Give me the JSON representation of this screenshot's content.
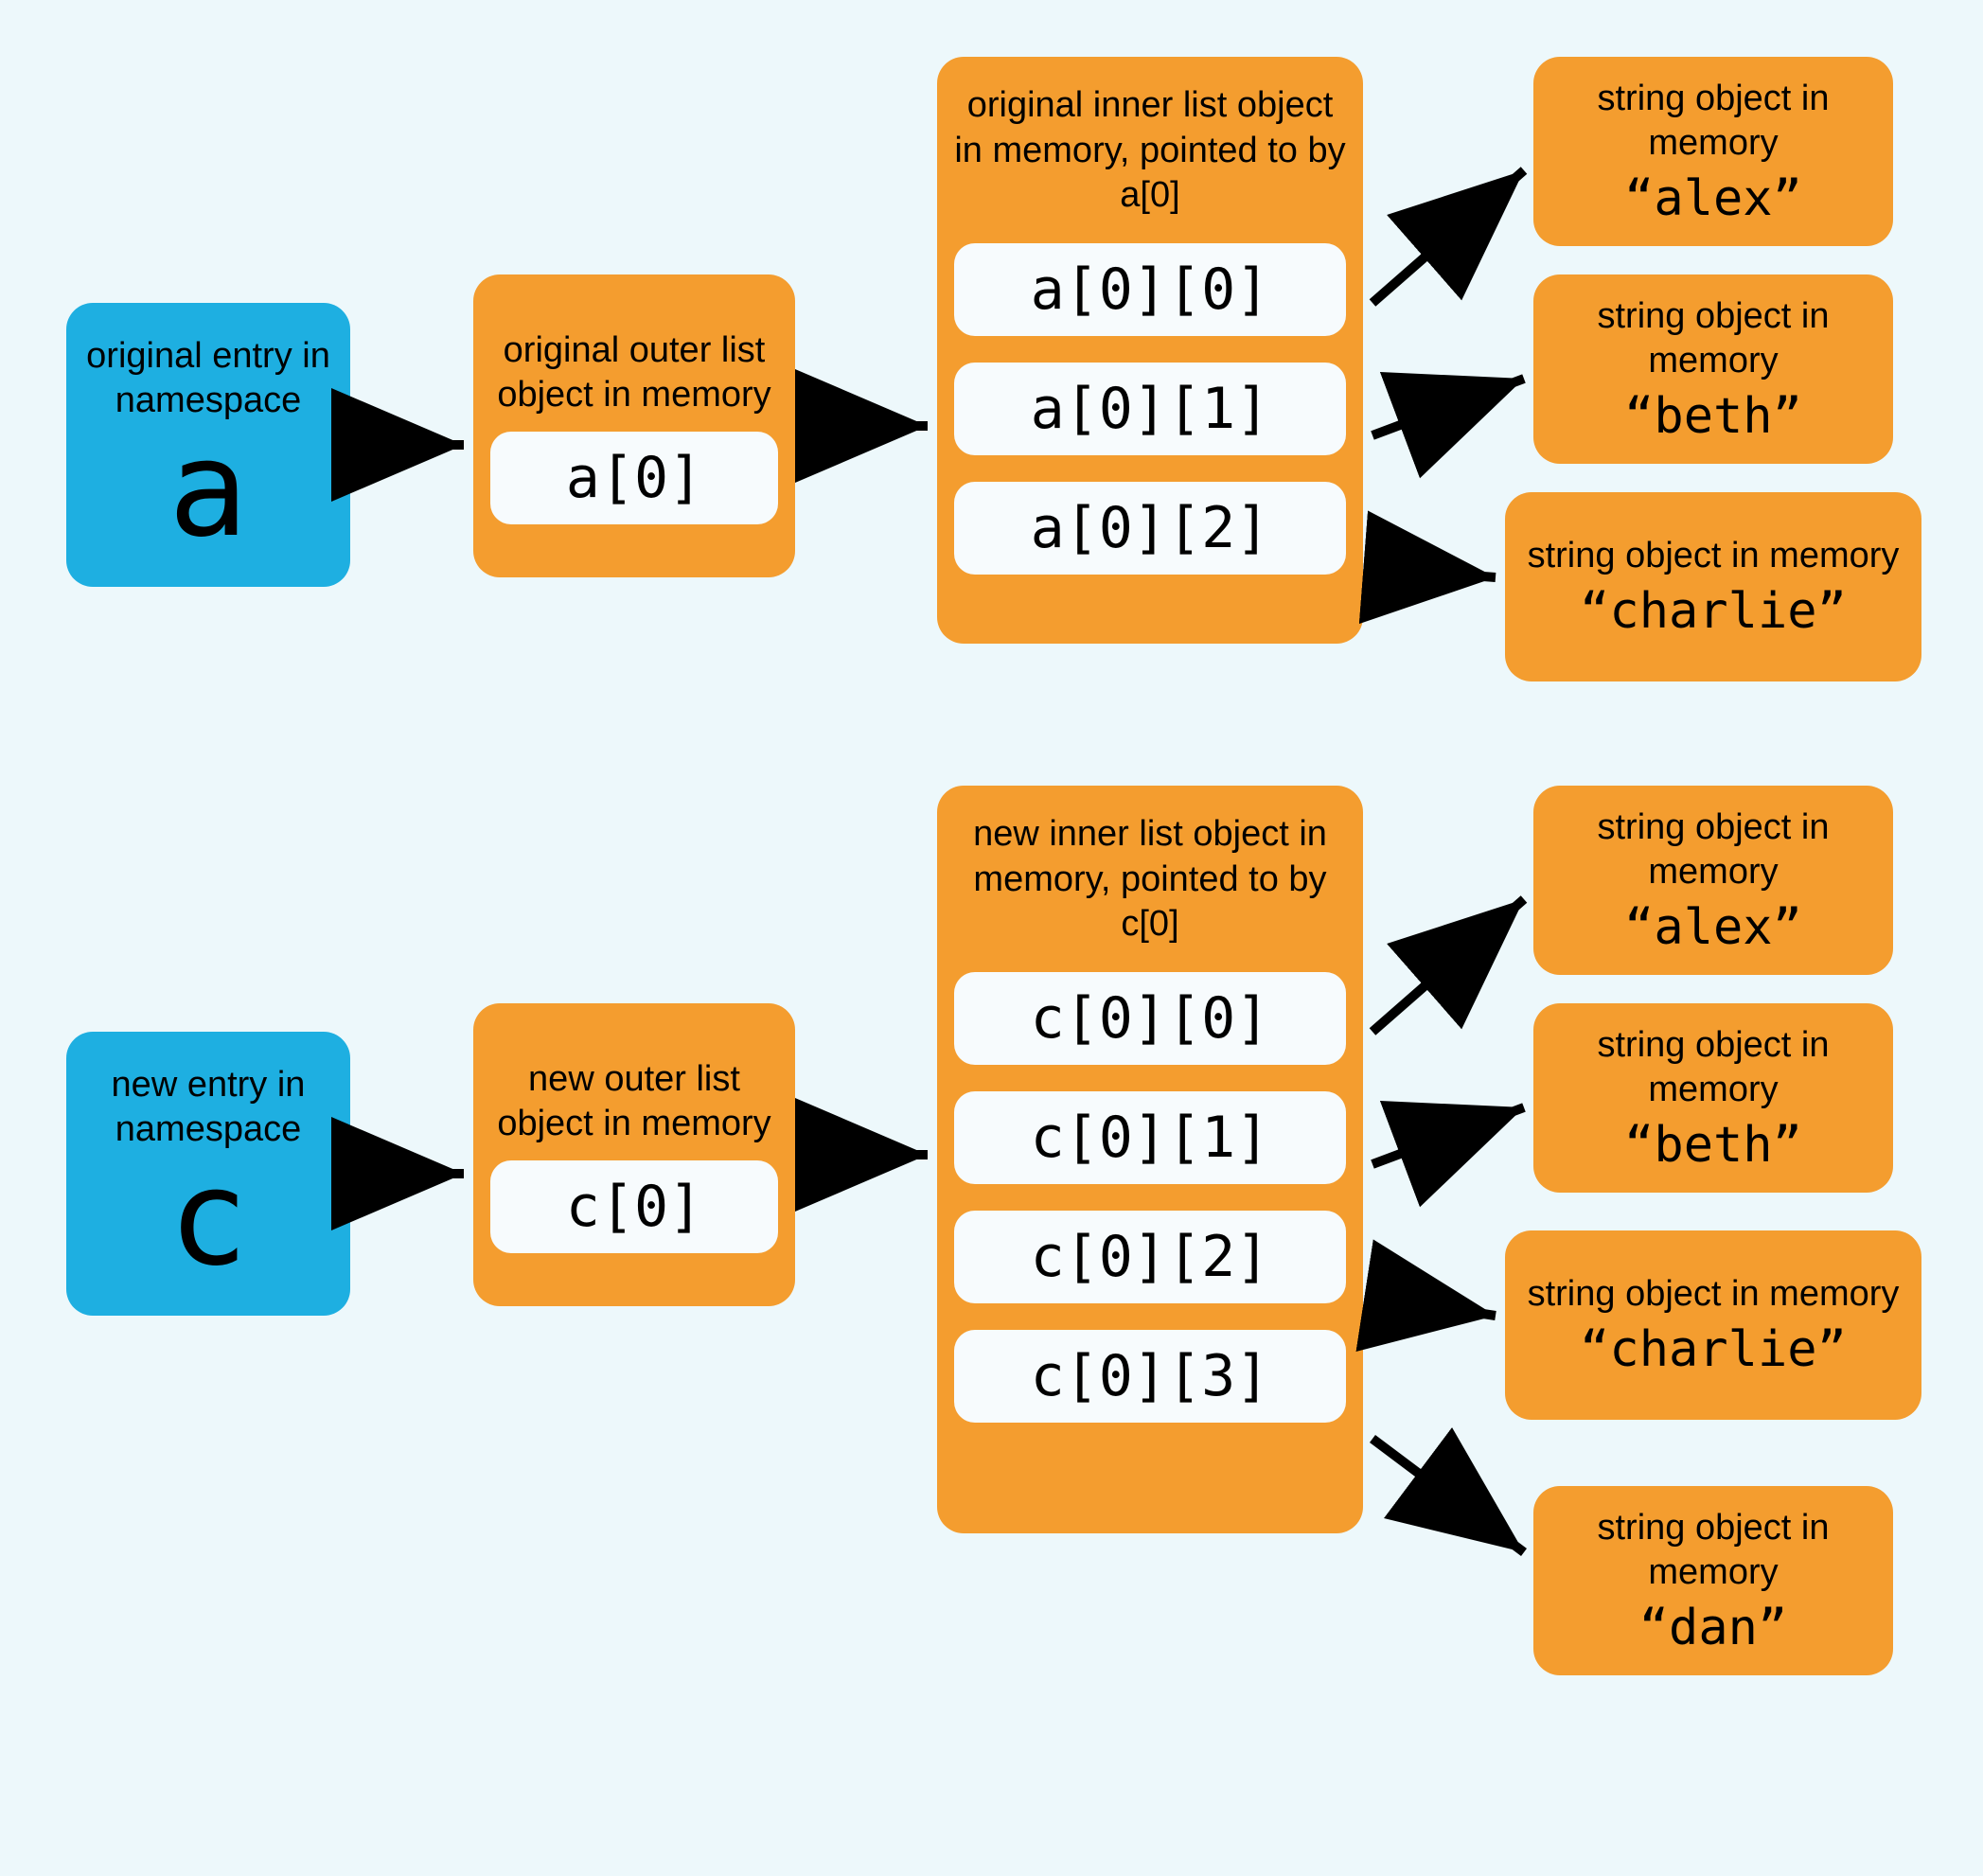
{
  "namespace_a": {
    "label": "original entry in namespace",
    "var": "a"
  },
  "namespace_c": {
    "label": "new entry in namespace",
    "var": "c"
  },
  "outer_a": {
    "label": "original outer list object in memory",
    "slot": "a[0]"
  },
  "outer_c": {
    "label": "new outer list object in memory",
    "slot": "c[0]"
  },
  "inner_a": {
    "label": "original inner list object in memory, pointed to by a[0]",
    "slots": [
      "a[0][0]",
      "a[0][1]",
      "a[0][2]"
    ]
  },
  "inner_c": {
    "label": "new inner list object in memory, pointed to by c[0]",
    "slots": [
      "c[0][0]",
      "c[0][1]",
      "c[0][2]",
      "c[0][3]"
    ]
  },
  "strings_a": [
    {
      "label": "string object in memory",
      "value": "“alex”"
    },
    {
      "label": "string object in memory",
      "value": "“beth”"
    },
    {
      "label": "string object in memory",
      "value": "“charlie”"
    }
  ],
  "strings_c": [
    {
      "label": "string object in memory",
      "value": "“alex”"
    },
    {
      "label": "string object in memory",
      "value": "“beth”"
    },
    {
      "label": "string object in memory",
      "value": "“charlie”"
    },
    {
      "label": "string object in memory",
      "value": "“dan”"
    }
  ]
}
